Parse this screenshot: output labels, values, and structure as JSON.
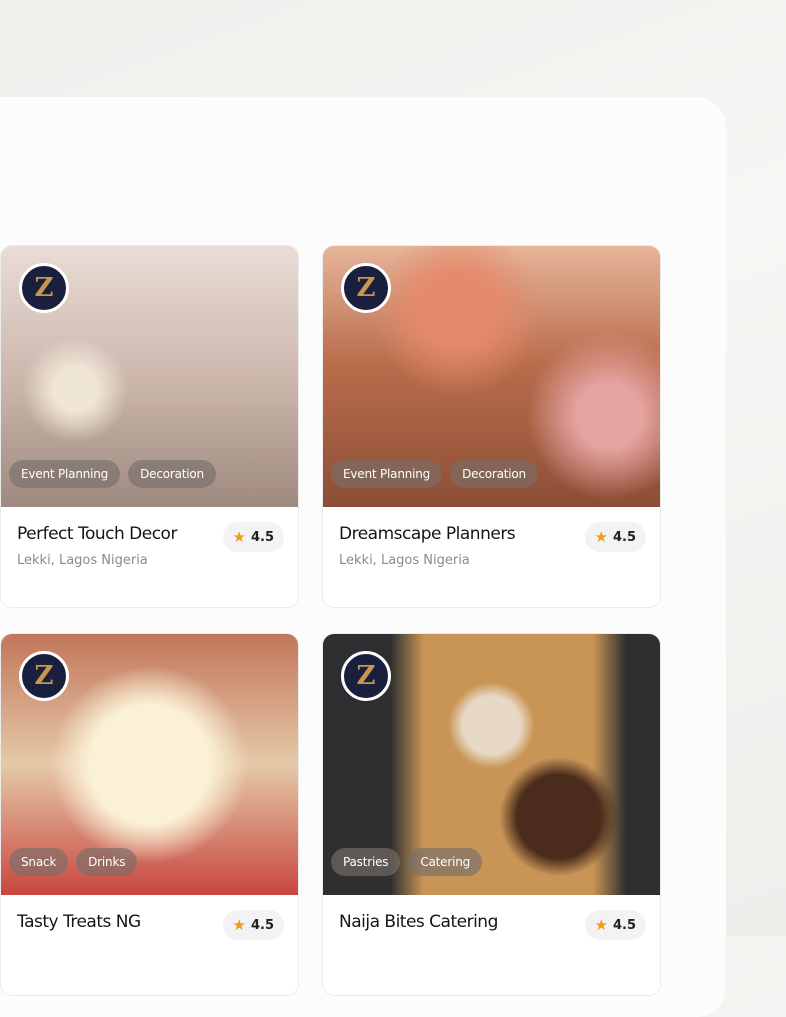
{
  "vendors": [
    {
      "name": "Perfect Touch Decor",
      "location": "Lekki, Lagos Nigeria",
      "rating": "4.5",
      "tags": [
        "Event Planning",
        "Decoration"
      ]
    },
    {
      "name": "Dreamscape Planners",
      "location": "Lekki, Lagos Nigeria",
      "rating": "4.5",
      "tags": [
        "Event Planning",
        "Decoration"
      ]
    },
    {
      "name": "Tasty Treats NG",
      "location": "",
      "rating": "4.5",
      "tags": [
        "Snack",
        "Drinks"
      ]
    },
    {
      "name": "Naija Bites Catering",
      "location": "",
      "rating": "4.5",
      "tags": [
        "Pastries",
        "Catering"
      ]
    }
  ],
  "icons": {
    "rating": "star-icon",
    "avatar": "vendor-logo"
  },
  "colors": {
    "star": "#f39a12",
    "avatar_bg": "#1b1f3e"
  }
}
